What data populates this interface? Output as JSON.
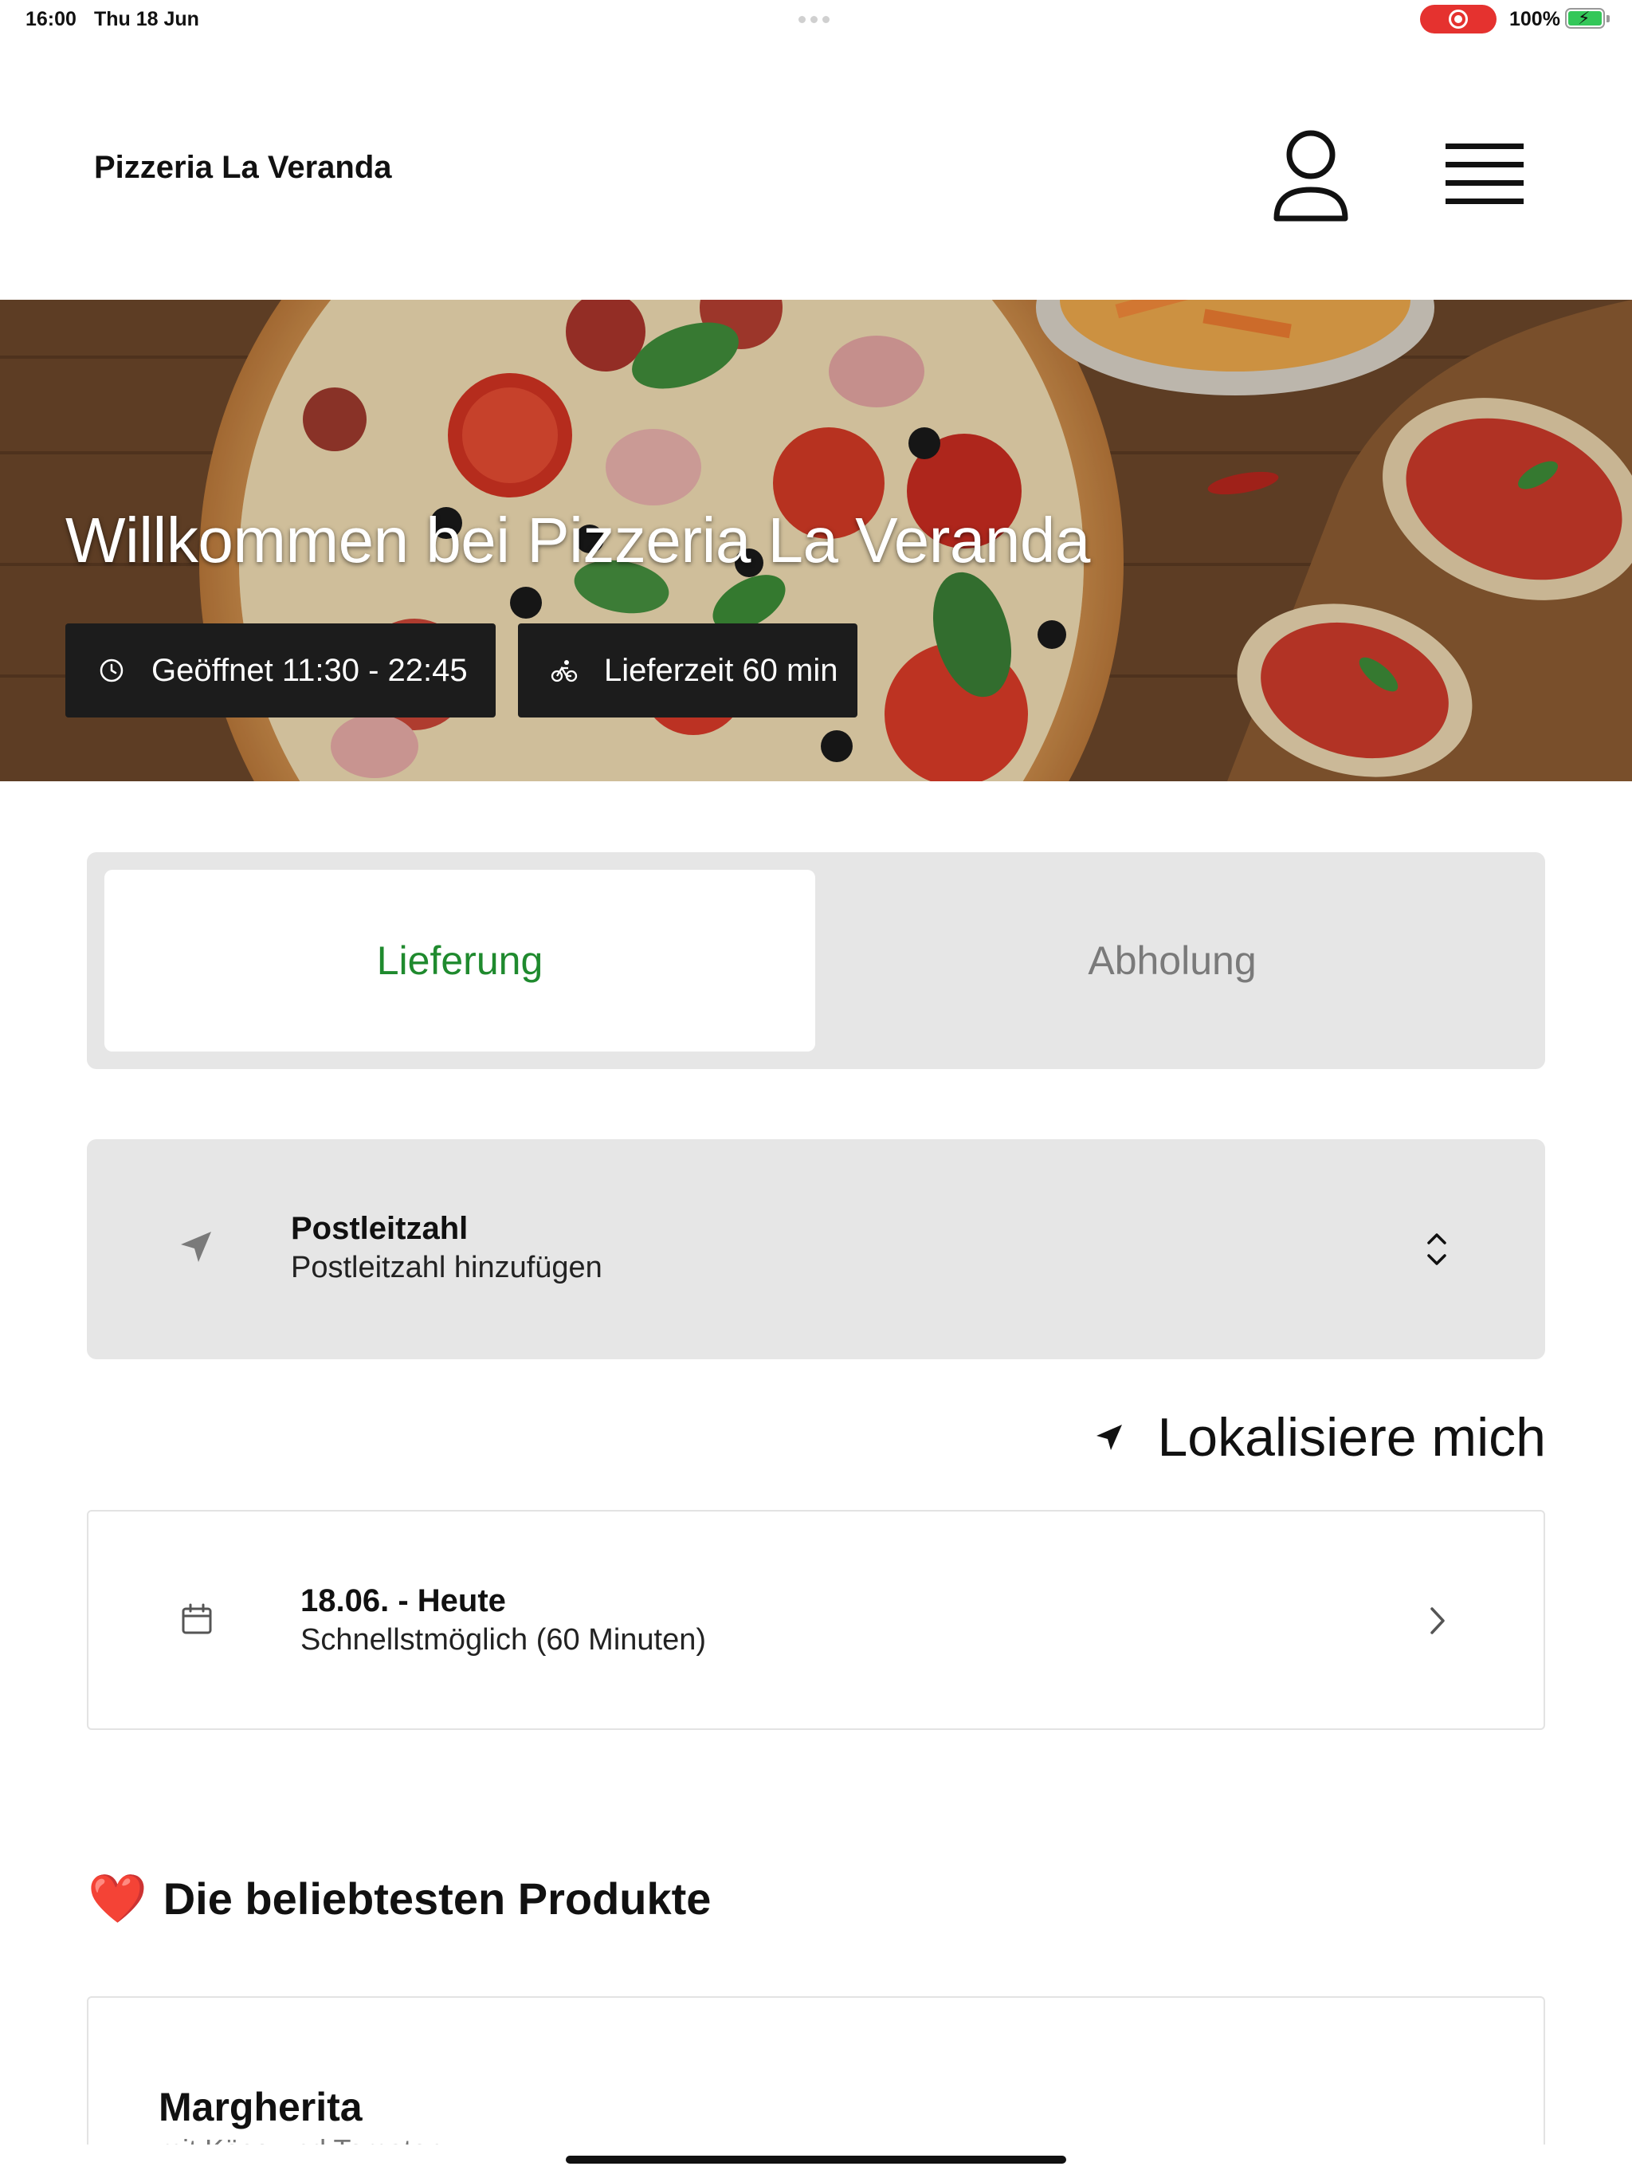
{
  "status_bar": {
    "time": "16:00",
    "date": "Thu 18 Jun",
    "battery_percent": "100%",
    "recording": true,
    "battery_level": 1.0,
    "charging": true
  },
  "header": {
    "brand": "Pizzeria La Veranda",
    "icons": [
      "user-icon",
      "menu-icon"
    ]
  },
  "hero": {
    "title": "Willkommen bei Pizzeria La Veranda",
    "open_hours": "Geöffnet 11:30 - 22:45",
    "delivery_time": "Lieferzeit 60 min"
  },
  "order_mode": {
    "options": [
      "Lieferung",
      "Abholung"
    ],
    "selected": "Lieferung"
  },
  "postcode": {
    "title": "Postleitzahl",
    "placeholder": "Postleitzahl hinzufügen"
  },
  "locate": {
    "label": "Lokalisiere mich"
  },
  "schedule": {
    "title": "18.06. - Heute",
    "subtitle": "Schnellstmöglich (60 Minuten)"
  },
  "popular": {
    "heading": "Die beliebtesten Produkte",
    "heading_emoji": "❤️",
    "items": [
      {
        "name": "Margherita",
        "desc": "mit Käse und Tomaten"
      }
    ]
  },
  "colors": {
    "accent_green": "#1f8a2e",
    "chip_bg": "#1c1c1c",
    "panel_bg": "#e6e6e6",
    "recording_red": "#e5322f"
  }
}
